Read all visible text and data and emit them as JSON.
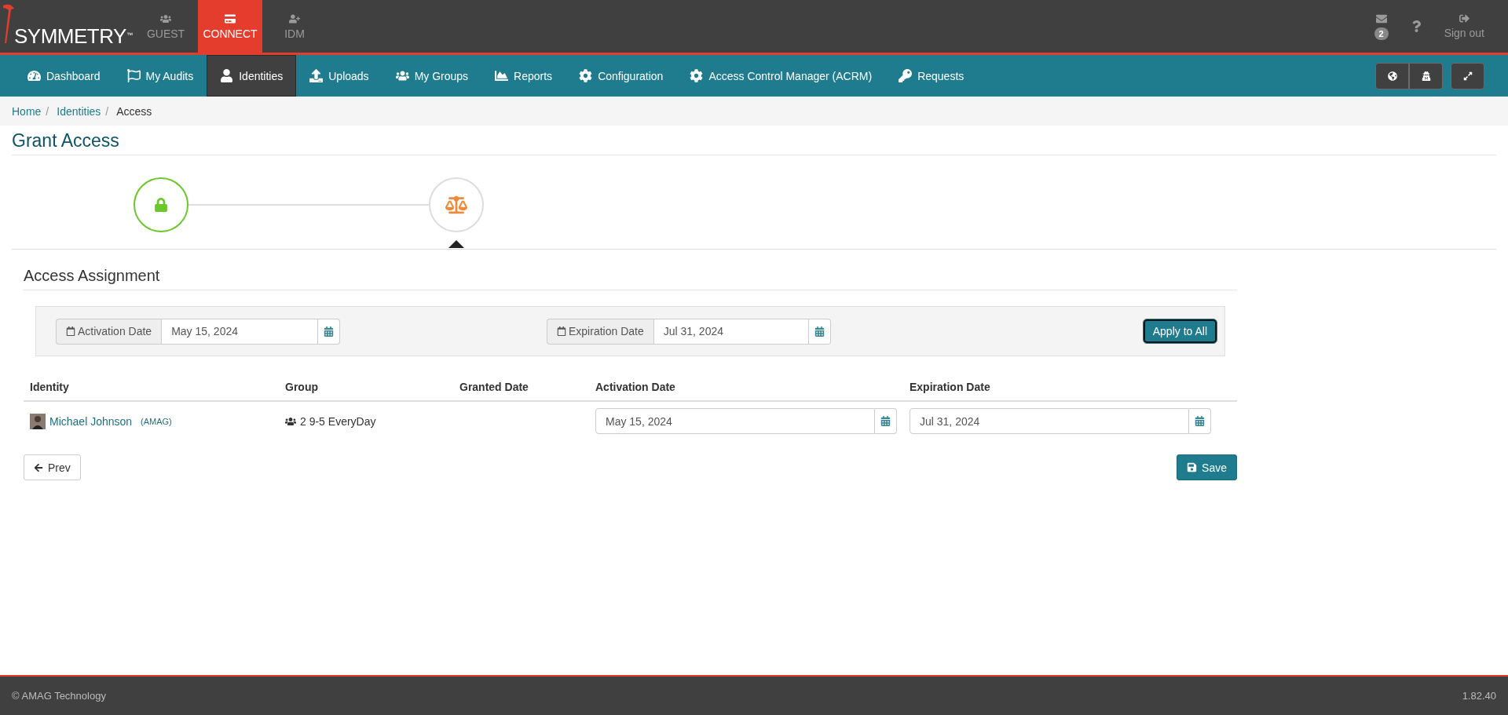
{
  "brand": {
    "name": "SYMMETRY",
    "mark": "™"
  },
  "apps": [
    {
      "label": "GUEST",
      "selected": false
    },
    {
      "label": "CONNECT",
      "selected": true
    },
    {
      "label": "IDM",
      "selected": false
    }
  ],
  "header_actions": {
    "messages_badge": "2",
    "sign_out": "Sign out"
  },
  "nav": [
    {
      "label": "Dashboard",
      "selected": false
    },
    {
      "label": "My Audits",
      "selected": false
    },
    {
      "label": "Identities",
      "selected": true
    },
    {
      "label": "Uploads",
      "selected": false
    },
    {
      "label": "My Groups",
      "selected": false
    },
    {
      "label": "Reports",
      "selected": false
    },
    {
      "label": "Configuration",
      "selected": false
    },
    {
      "label": "Access Control Manager (ACRM)",
      "selected": false
    },
    {
      "label": "Requests",
      "selected": false
    }
  ],
  "breadcrumb": [
    {
      "label": "Home",
      "link": true,
      "separator": "/"
    },
    {
      "label": "Identities",
      "link": true,
      "separator": "/"
    },
    {
      "label": "Access",
      "link": false
    }
  ],
  "page_title": "Grant Access",
  "steps": [
    {
      "completed": true,
      "selected": false
    },
    {
      "completed": false,
      "selected": true
    }
  ],
  "section_title": "Access Assignment",
  "bulk": {
    "activation": {
      "label": "Activation Date",
      "value": "May 15, 2024"
    },
    "expiration": {
      "label": "Expiration Date",
      "value": "Jul 31, 2024"
    },
    "apply": "Apply to All"
  },
  "table": {
    "columns": [
      "Identity",
      "Group",
      "Granted Date",
      "Activation Date",
      "Expiration Date"
    ],
    "rows": [
      {
        "identity": "Michael Johnson",
        "org": "(AMAG)",
        "group": "2 9-5 EveryDay",
        "activation": "May 15, 2024",
        "expiration": "Jul 31, 2024"
      }
    ]
  },
  "buttons": {
    "prev": "Prev",
    "save": "Save"
  },
  "footer": {
    "copyright": "© AMAG Technology",
    "version": "1.82.40"
  }
}
